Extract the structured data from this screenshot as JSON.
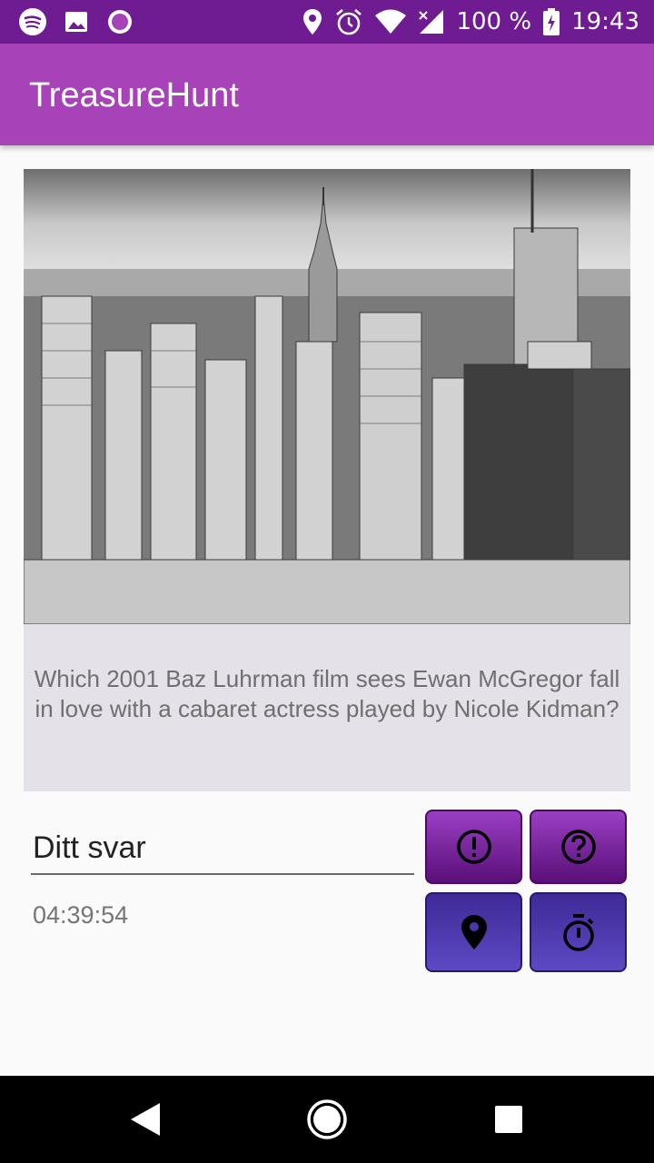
{
  "status_bar": {
    "battery": "100 %",
    "time": "19:43",
    "left_icons": [
      "spotify-icon",
      "gallery-icon",
      "record-icon"
    ],
    "right_icons": [
      "location-icon",
      "alarm-icon",
      "wifi-icon",
      "signal-icon",
      "battery-charging-icon"
    ]
  },
  "app_bar": {
    "title": "TreasureHunt"
  },
  "question_card": {
    "image": "city-skyline-photo",
    "question": "Which 2001 Baz Luhrman film sees Ewan McGregor fall in love with a cabaret actress played by Nicole Kidman?"
  },
  "answer": {
    "placeholder": "Ditt svar",
    "value": ""
  },
  "timer": "04:39:54",
  "actions": [
    {
      "icon": "exclamation-icon",
      "color": "#7a2aa6"
    },
    {
      "icon": "question-icon",
      "color": "#7a2aa6"
    },
    {
      "icon": "location-pin-icon",
      "color": "#4b37ad"
    },
    {
      "icon": "stopwatch-icon",
      "color": "#4b37ad"
    }
  ],
  "colors": {
    "status_bar": "#6f1c93",
    "app_bar": "#a742b8",
    "card": "#e5e1e8",
    "nav_bar": "#000000"
  },
  "nav_bar": [
    "back-icon",
    "home-icon",
    "recents-icon"
  ]
}
